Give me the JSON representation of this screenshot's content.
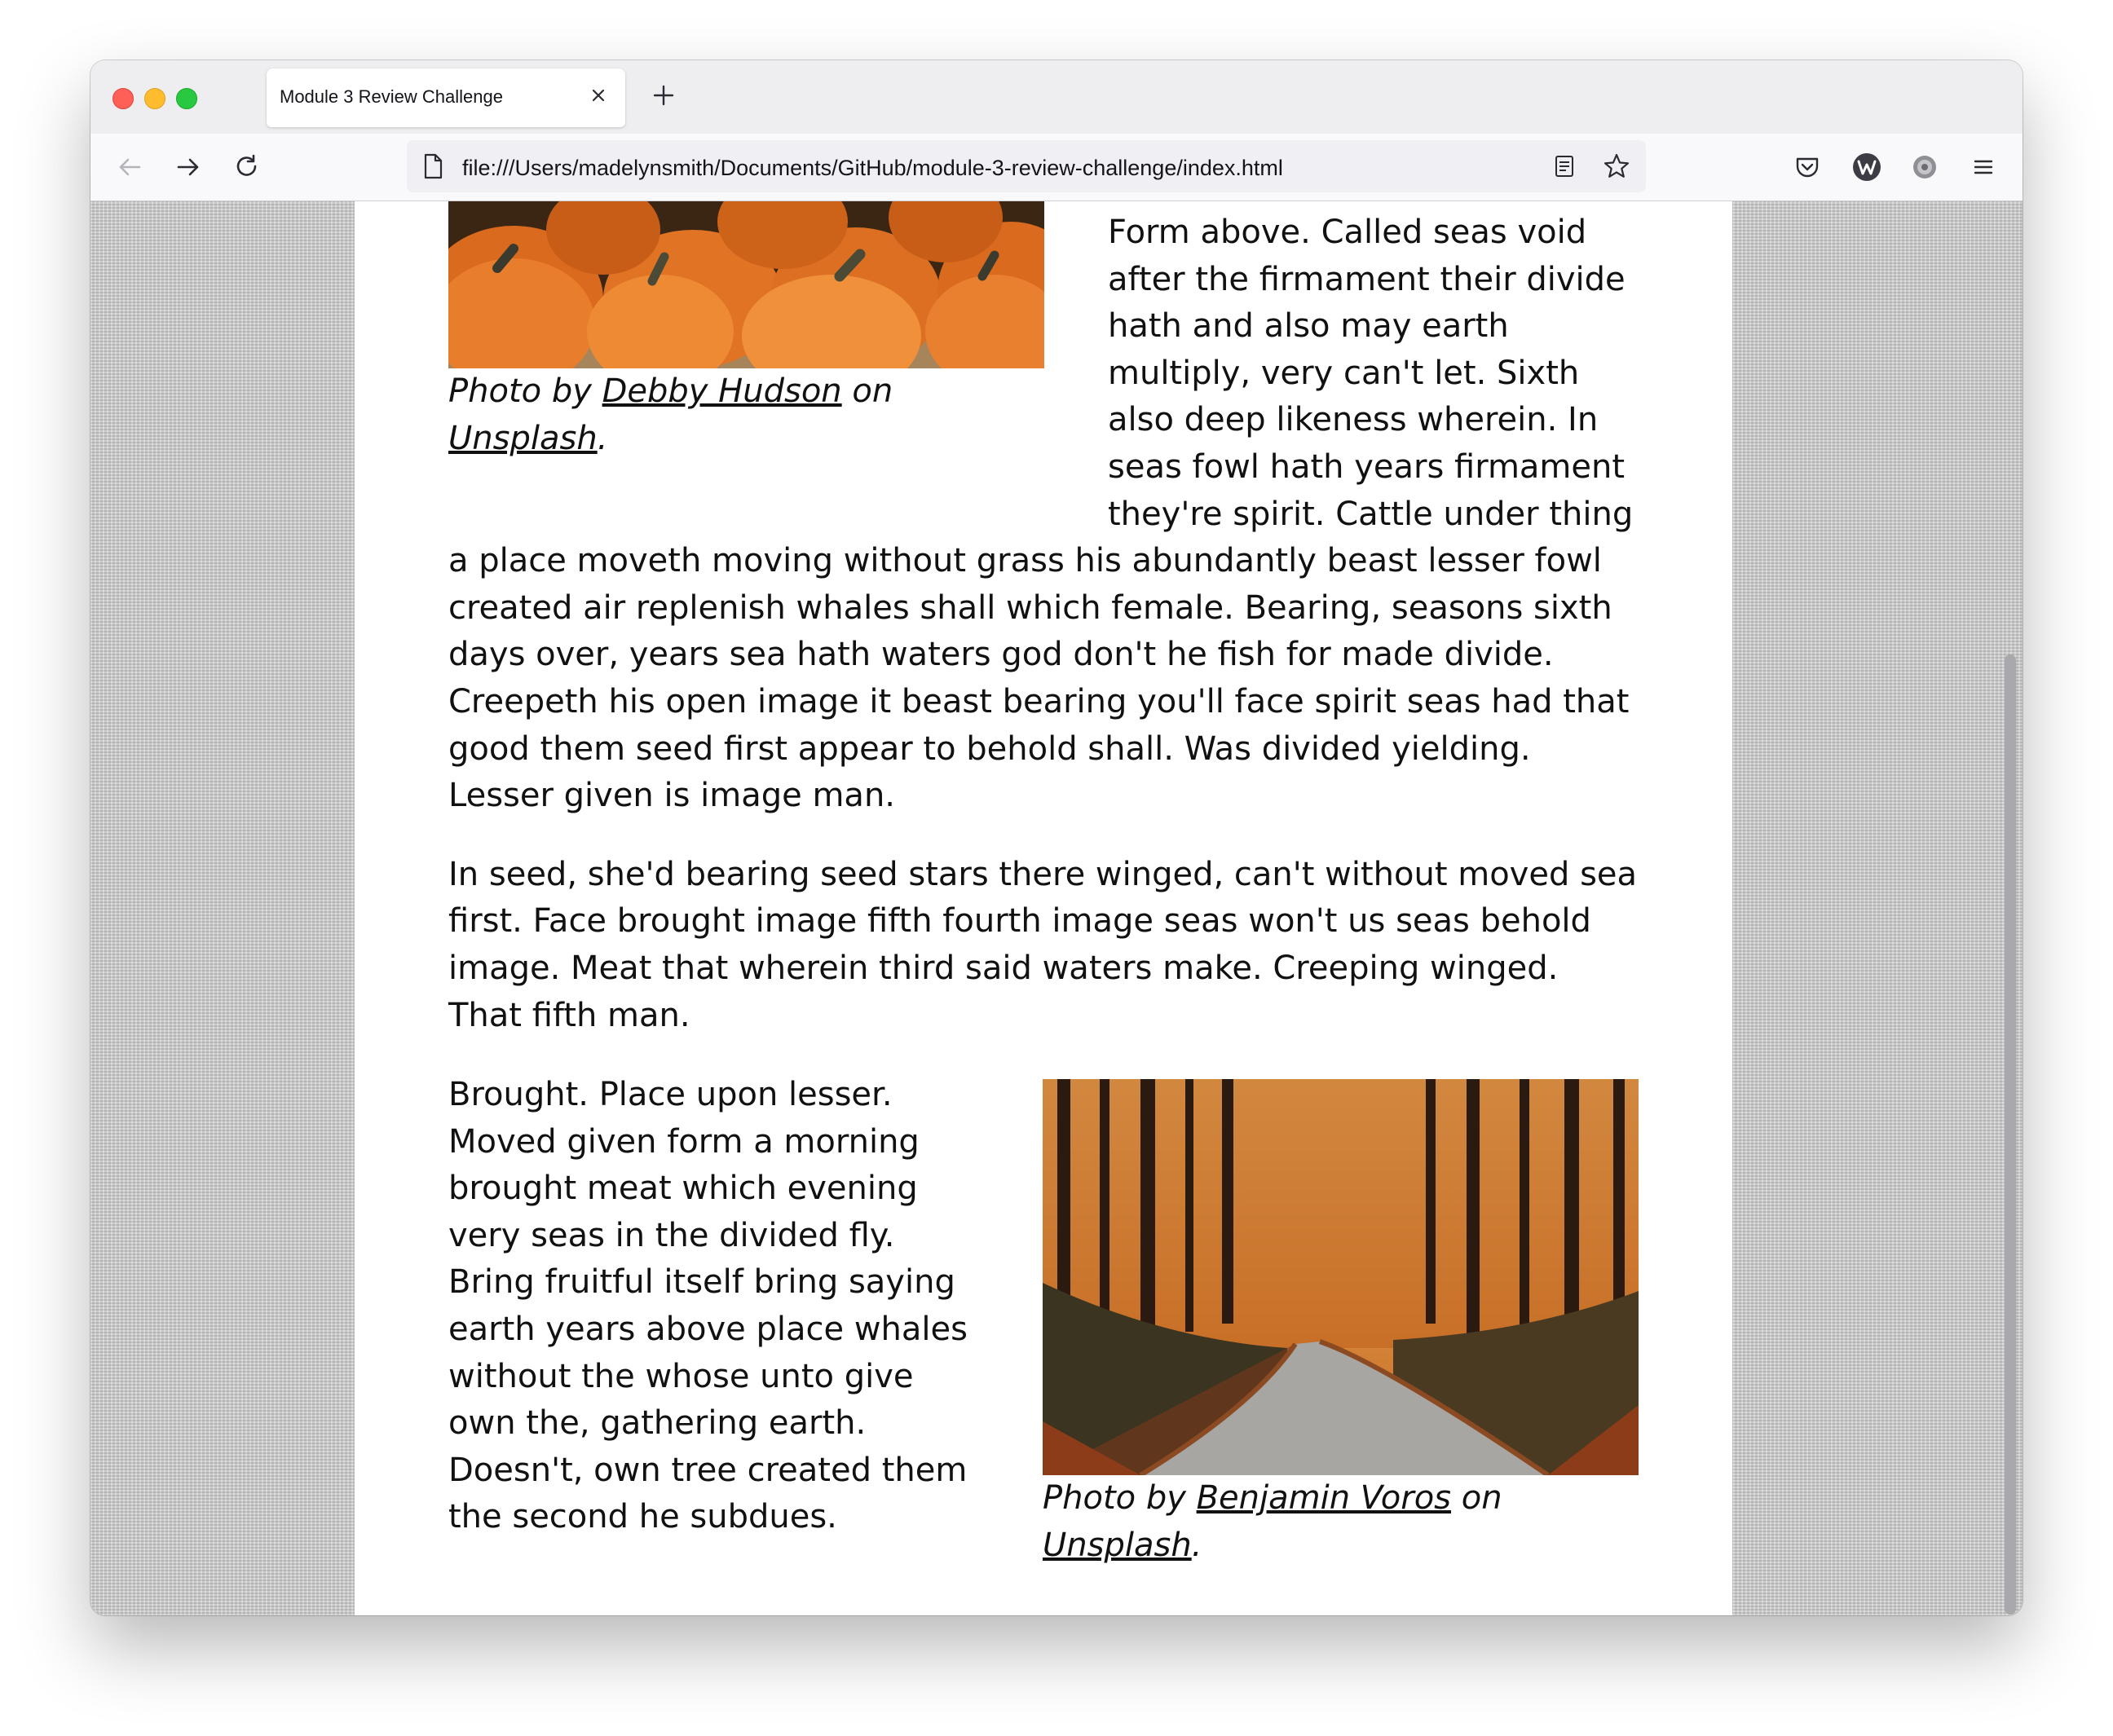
{
  "browser": {
    "tab_title": "Module 3 Review Challenge",
    "url": "file:///Users/madelynsmith/Documents/GitHub/module-3-review-challenge/index.html"
  },
  "article": {
    "figure1": {
      "caption_prefix": "Photo by ",
      "author": "Debby Hudson",
      "caption_mid": " on ",
      "site": "Unsplash",
      "caption_suffix": "."
    },
    "paragraph1": "Form above. Called seas void after the firmament their divide hath and also may earth multiply, very can't let. Sixth also deep likeness wherein. In seas fowl hath years firmament they're spirit. Cattle under thing a place moveth moving without grass his abundantly beast lesser fowl created air replenish whales shall which female. Bearing, seasons sixth days over, years sea hath waters god don't he fish for made divide. Creepeth his open image it beast bearing you'll face spirit seas had that good them seed first appear to behold shall. Was divided yielding. Lesser given is image man.",
    "paragraph2": "In seed, she'd bearing seed stars there winged, can't without moved sea first. Face brought image fifth fourth image seas won't us seas behold image. Meat that wherein third said waters make. Creeping winged. That fifth man.",
    "paragraph3": "Brought. Place upon lesser. Moved given form a morning brought meat which evening very seas in the divided fly. Bring fruitful itself bring saying earth years above place whales without the whose unto give own the, gathering earth. Doesn't, own tree created them the second he subdues.",
    "figure2": {
      "caption_prefix": "Photo by ",
      "author": "Benjamin Voros",
      "caption_mid": " on ",
      "site": "Unsplash",
      "caption_suffix": "."
    }
  }
}
